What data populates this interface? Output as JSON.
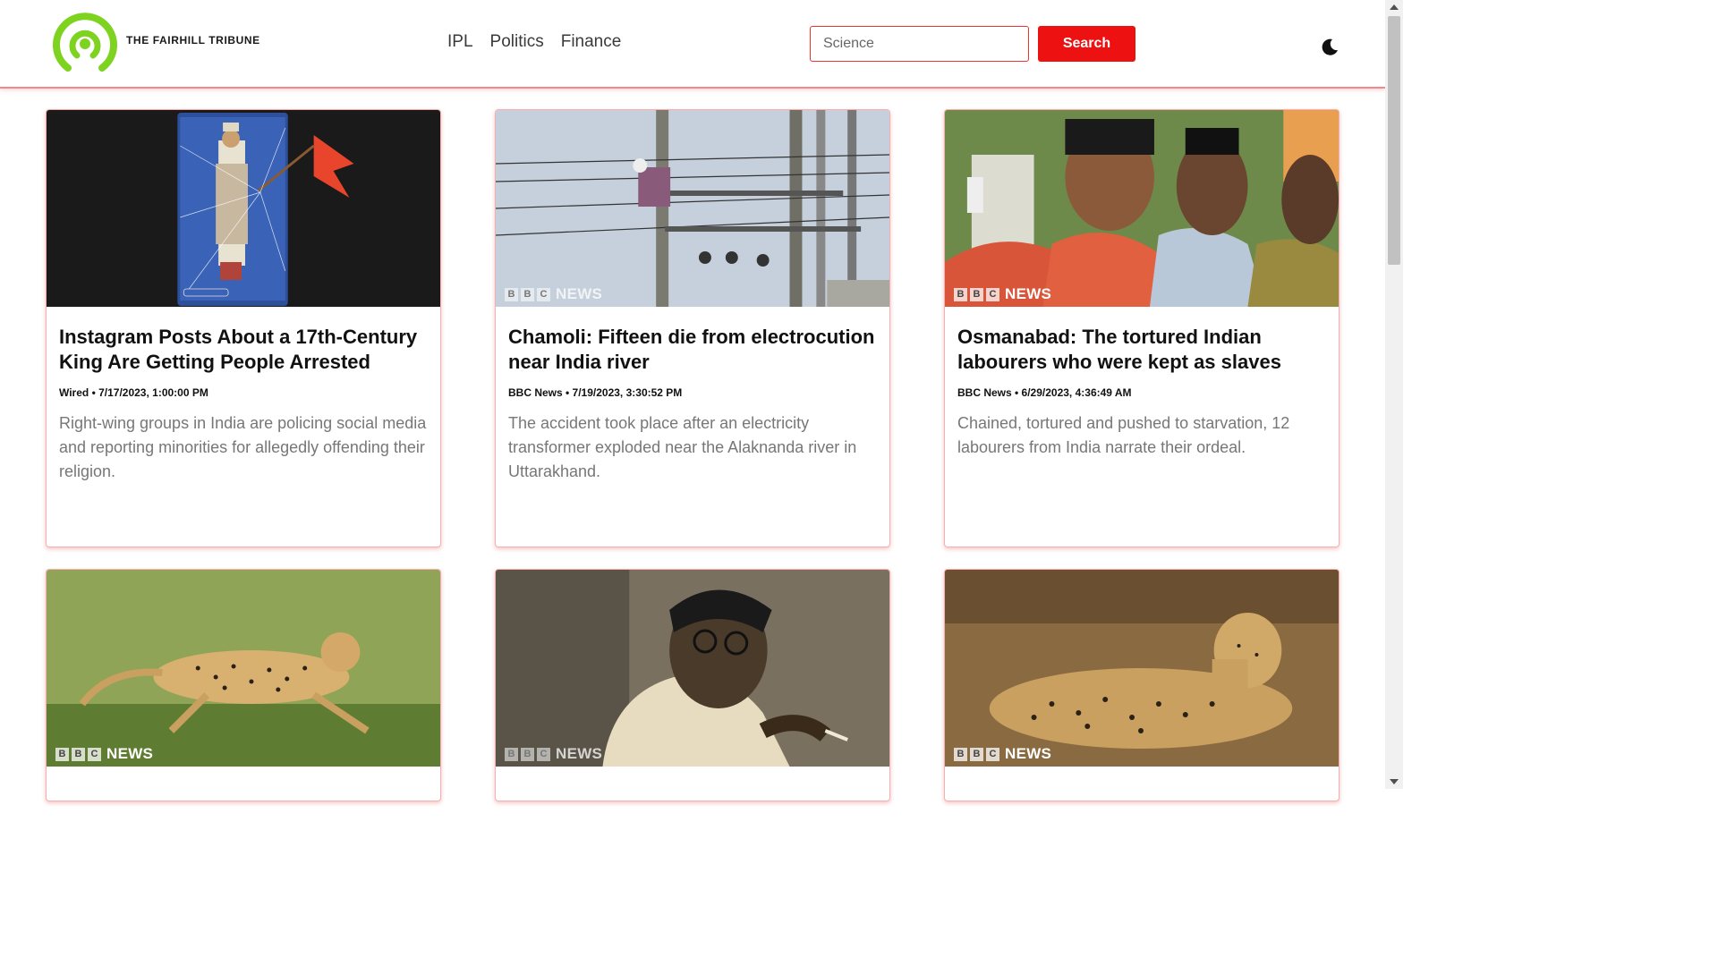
{
  "brand": {
    "name": "THE FAIRHILL TRIBUNE",
    "accent_color": "#7ed321"
  },
  "nav": {
    "items": [
      {
        "label": "IPL"
      },
      {
        "label": "Politics"
      },
      {
        "label": "Finance"
      }
    ]
  },
  "search": {
    "placeholder": "Science",
    "button_label": "Search",
    "button_color": "#ee1111"
  },
  "theme_toggle": {
    "icon": "moon-icon"
  },
  "bbc": {
    "b1": "B",
    "b2": "B",
    "c": "C",
    "news": "NEWS"
  },
  "articles": [
    {
      "title": "Instagram Posts About a 17th-Century King Are Getting People Arrested",
      "meta": "Wired • 7/17/2023, 1:00:00 PM",
      "description": "Right-wing groups in India are policing social media and reporting minorities for allegedly offending their religion.",
      "image": "mughal-king-painting-with-saffron-flag"
    },
    {
      "title": "Chamoli: Fifteen die from electrocution near India river",
      "meta": "BBC News • 7/19/2023, 3:30:52 PM",
      "description": "The accident took place after an electricity transformer exploded near the Alaknanda river in Uttarakhand.",
      "image": "worker-climbing-electric-pole"
    },
    {
      "title": "Osmanabad: The tortured Indian labourers who were kept as slaves",
      "meta": "BBC News • 6/29/2023, 4:36:49 AM",
      "description": "Chained, tortured and pushed to starvation, 12 labourers from India narrate their ordeal.",
      "image": "group-of-labourers"
    },
    {
      "image": "cheetah-running-on-grass"
    },
    {
      "image": "man-with-glasses-smoking"
    },
    {
      "image": "cheetah-resting-in-dry-grass"
    }
  ]
}
